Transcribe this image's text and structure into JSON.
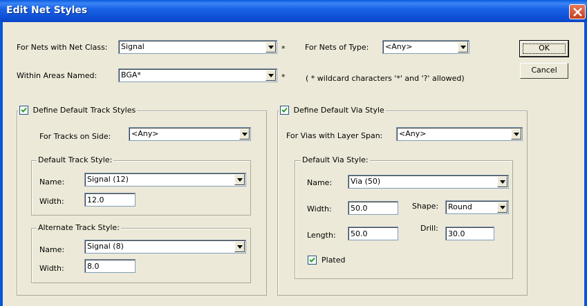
{
  "window": {
    "title": "Edit Net Styles"
  },
  "net_class": {
    "label": "For Nets with Net Class:",
    "value": "Signal",
    "wildcard_mark": "*"
  },
  "net_type": {
    "label": "For Nets of Type:",
    "value": "<Any>"
  },
  "areas": {
    "label": "Within Areas Named:",
    "value": "BGA*",
    "wildcard_mark": "*"
  },
  "wildcard_note": "( * wildcard characters '*' and '?' allowed)",
  "buttons": {
    "ok": "OK",
    "cancel": "Cancel"
  },
  "track": {
    "define_label": "Define Default Track Styles",
    "define_checked": true,
    "side_label": "For Tracks on Side:",
    "side_value": "<Any>",
    "default": {
      "group_label": "Default Track Style:",
      "name_label": "Name:",
      "name_value": "Signal (12)",
      "width_label": "Width:",
      "width_value": "12.0"
    },
    "alternate": {
      "group_label": "Alternate Track Style:",
      "name_label": "Name:",
      "name_value": "Signal (8)",
      "width_label": "Width:",
      "width_value": "8.0"
    }
  },
  "via": {
    "define_label": "Define Default Via Style",
    "define_checked": true,
    "span_label": "For Vias with Layer Span:",
    "span_value": "<Any>",
    "default": {
      "group_label": "Default Via Style:",
      "name_label": "Name:",
      "name_value": "Via (50)",
      "width_label": "Width:",
      "width_value": "50.0",
      "shape_label": "Shape:",
      "shape_value": "Round",
      "length_label": "Length:",
      "length_value": "50.0",
      "drill_label": "Drill:",
      "drill_value": "30.0",
      "plated_label": "Plated",
      "plated_checked": true
    }
  },
  "colors": {
    "title_bar": "#0a5ce0",
    "dialog_bg": "#ece9d8",
    "close_button": "#d9572e"
  }
}
